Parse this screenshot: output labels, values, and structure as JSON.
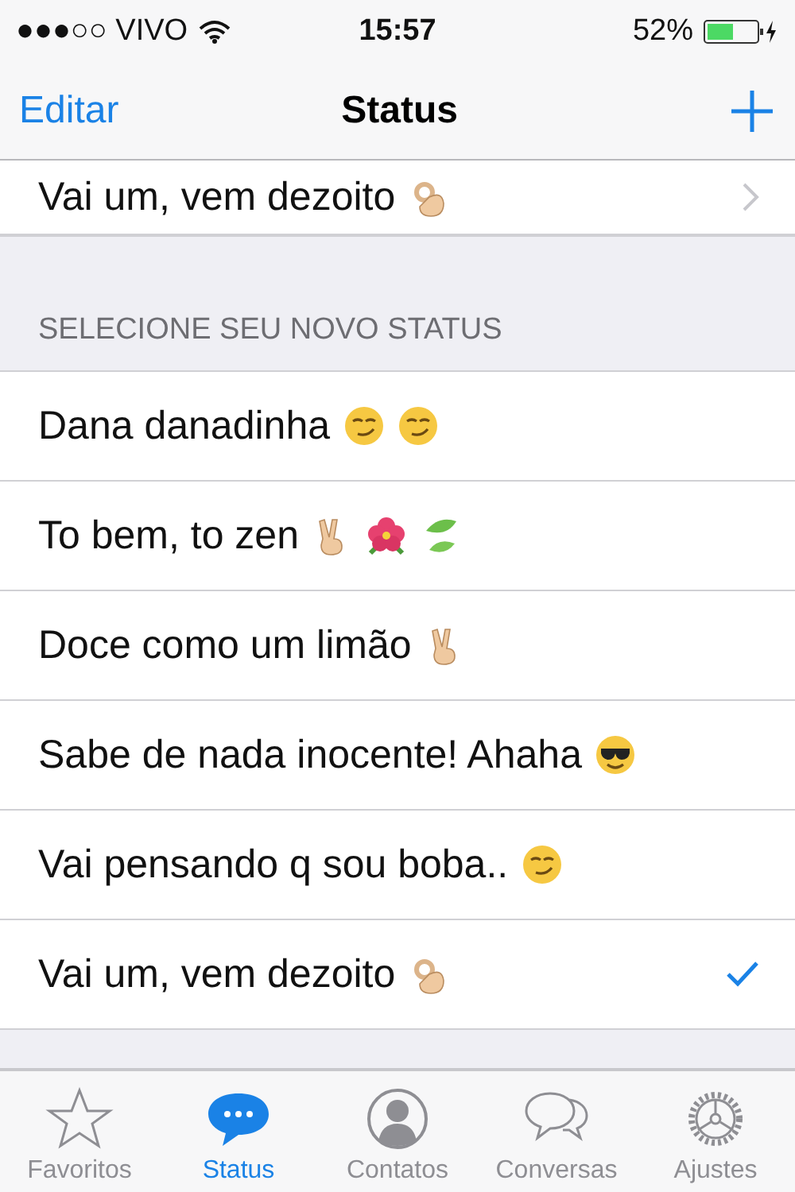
{
  "status_bar": {
    "carrier": "●●●○○ VIVO",
    "time": "15:57",
    "battery": "52%"
  },
  "nav": {
    "left": "Editar",
    "title": "Status"
  },
  "current": {
    "text": "Vai um, vem dezoito",
    "icons": [
      {
        "kind": "ok"
      }
    ]
  },
  "section": "SELECIONE SEU NOVO STATUS",
  "statuses": [
    {
      "text": "Dana danadinha",
      "icons": [
        {
          "kind": "smirk"
        },
        {
          "kind": "smirk"
        }
      ],
      "selected": false
    },
    {
      "text": "To bem, to zen",
      "icons": [
        {
          "kind": "victory"
        },
        {
          "kind": "hibiscus"
        },
        {
          "kind": "leaves"
        }
      ],
      "selected": false
    },
    {
      "text": "Doce como um limão",
      "icons": [
        {
          "kind": "victory"
        }
      ],
      "selected": false
    },
    {
      "text": "Sabe de nada inocente! Ahaha",
      "icons": [
        {
          "kind": "sunglasses"
        }
      ],
      "selected": false
    },
    {
      "text": "Vai pensando q sou boba..",
      "icons": [
        {
          "kind": "smirk"
        }
      ],
      "selected": false
    },
    {
      "text": "Vai um, vem dezoito",
      "icons": [
        {
          "kind": "ok"
        }
      ],
      "selected": true
    }
  ],
  "tabs": [
    {
      "label": "Favoritos",
      "kind": "star",
      "selected": false
    },
    {
      "label": "Status",
      "kind": "bubble",
      "selected": true
    },
    {
      "label": "Contatos",
      "kind": "person",
      "selected": false
    },
    {
      "label": "Conversas",
      "kind": "chats",
      "selected": false
    },
    {
      "label": "Ajustes",
      "kind": "gear",
      "selected": false
    }
  ]
}
